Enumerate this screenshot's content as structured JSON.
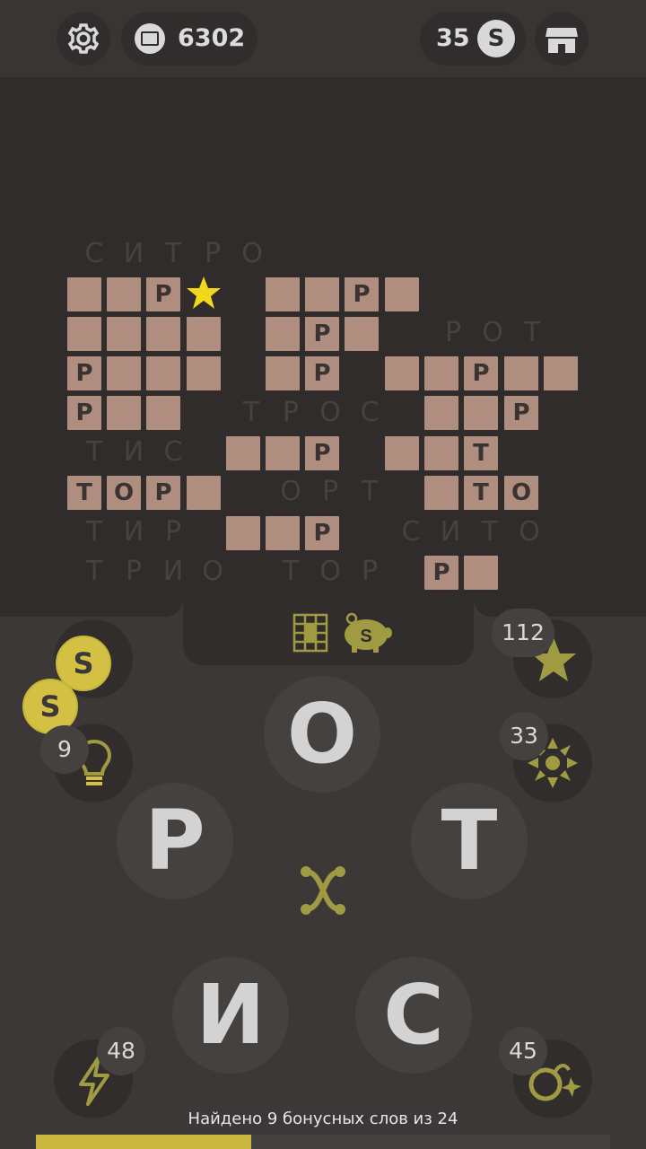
{
  "header": {
    "coins": "6302",
    "s_count": "35",
    "s_badge": "S"
  },
  "board": {
    "words": [
      {
        "letters": [
          "С",
          "И",
          "Т",
          "Р",
          "О"
        ]
      },
      {
        "letters": [
          "Р",
          "О",
          "Т"
        ]
      },
      {
        "letters": [
          "Т",
          "Р",
          "О",
          "С"
        ]
      },
      {
        "letters": [
          "Т",
          "И",
          "С"
        ]
      },
      {
        "letters": [
          "О",
          "Р",
          "Т"
        ]
      },
      {
        "letters": [
          "Т",
          "И",
          "Р"
        ]
      },
      {
        "letters": [
          "С",
          "И",
          "Т",
          "О"
        ]
      },
      {
        "letters": [
          "Т",
          "Р",
          "И",
          "О"
        ]
      },
      {
        "letters": [
          "Т",
          "О",
          "Р"
        ]
      }
    ],
    "cells": [
      {
        "t": ""
      },
      {
        "t": ""
      },
      {
        "t": "Р"
      },
      {
        "t": ""
      },
      {
        "t": ""
      },
      {
        "t": "Р"
      },
      {
        "t": ""
      },
      {
        "t": ""
      },
      {
        "t": ""
      },
      {
        "t": ""
      },
      {
        "t": ""
      },
      {
        "t": ""
      },
      {
        "t": "Р"
      },
      {
        "t": ""
      },
      {
        "t": "Р"
      },
      {
        "t": ""
      },
      {
        "t": ""
      },
      {
        "t": ""
      },
      {
        "t": ""
      },
      {
        "t": "Р"
      },
      {
        "t": ""
      },
      {
        "t": ""
      },
      {
        "t": "Р"
      },
      {
        "t": ""
      },
      {
        "t": ""
      },
      {
        "t": "Р"
      },
      {
        "t": ""
      },
      {
        "t": ""
      },
      {
        "t": ""
      },
      {
        "t": ""
      },
      {
        "t": "Р"
      },
      {
        "t": ""
      },
      {
        "t": ""
      },
      {
        "t": "Р"
      },
      {
        "t": ""
      },
      {
        "t": ""
      },
      {
        "t": "Р"
      },
      {
        "t": ""
      },
      {
        "t": ""
      },
      {
        "t": "Т"
      },
      {
        "t": "Т"
      },
      {
        "t": "О"
      },
      {
        "t": "Р"
      },
      {
        "t": ""
      },
      {
        "t": ""
      },
      {
        "t": "Т"
      },
      {
        "t": "О"
      },
      {
        "t": ""
      },
      {
        "t": ""
      },
      {
        "t": "Р"
      },
      {
        "t": "Р"
      },
      {
        "t": ""
      }
    ]
  },
  "wheel": {
    "letters": [
      "О",
      "Р",
      "Т",
      "И",
      "С"
    ]
  },
  "boosters": {
    "hint_count": "9",
    "star_count": "112",
    "reveal_count": "33",
    "lightning_count": "48",
    "bomb_count": "45",
    "coin_label": "S"
  },
  "status": {
    "text": "Найдено 9 бонусных слов из 24",
    "progress": 0.375
  }
}
